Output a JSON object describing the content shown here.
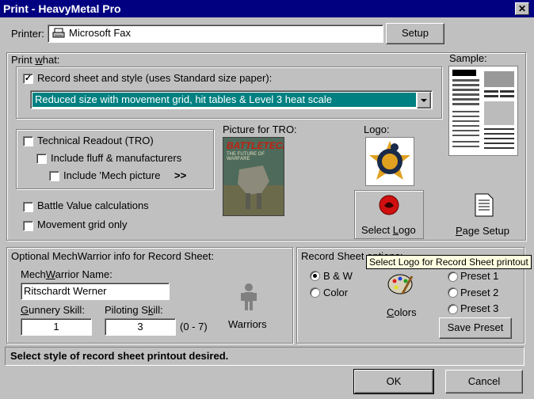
{
  "window": {
    "title": "Print - HeavyMetal Pro",
    "close_glyph": "✕"
  },
  "printer": {
    "label": "Printer:",
    "value": "Microsoft Fax",
    "setup_label": "Setup"
  },
  "print_what": {
    "title": "Print what:",
    "record_sheet": {
      "label": "Record sheet and style (uses Standard size paper):",
      "checked": true
    },
    "style_select": "Reduced size with movement grid, hit tables & Level 3 heat scale",
    "tro": {
      "label": "Technical Readout (TRO)",
      "checked": false
    },
    "fluff": {
      "label": "Include fluff & manufacturers",
      "checked": false
    },
    "mech_picture": {
      "label": "Include 'Mech picture",
      "checked": false
    },
    "more": ">>",
    "picture_for_tro_label": "Picture for TRO:",
    "tro_image_text": "BATTLETECH",
    "tro_image_subtext": "THE FUTURE OF WARFARE",
    "logo_label": "Logo:",
    "battle_value": {
      "label": "Battle Value calculations",
      "checked": false
    },
    "movement_grid": {
      "label": "Movement grid only",
      "checked": false
    },
    "select_logo_label": "Select Logo",
    "page_setup_label": "Page Setup"
  },
  "sample": {
    "label": "Sample:"
  },
  "mechwarrior": {
    "title": "Optional MechWarrior info for Record Sheet:",
    "name_label": "MechWarrior Name:",
    "name_value": "Ritschardt Werner",
    "gunnery_label": "Gunnery Skill:",
    "gunnery_value": "1",
    "piloting_label": "Piloting Skill:",
    "piloting_value": "3",
    "range": "(0 - 7)",
    "warriors_label": "Warriors"
  },
  "record_options": {
    "title": "Record Sheet options:",
    "bw": {
      "label": "B & W",
      "selected": true
    },
    "color": {
      "label": "Color",
      "selected": false
    },
    "colors_label": "Colors",
    "preset1": "Preset 1",
    "preset2": "Preset 2",
    "preset3": "Preset 3",
    "save_preset": "Save Preset"
  },
  "tooltip": "Select Logo for Record Sheet printout",
  "status": "Select style of record sheet printout desired.",
  "buttons": {
    "ok": "OK",
    "cancel": "Cancel"
  },
  "colors": {
    "titlebar": "#000080",
    "selection": "#008080",
    "face": "#c0c0c0"
  },
  "icons": [
    "printer-icon",
    "battletech-image",
    "logo-image",
    "select-logo-icon",
    "page-setup-icon",
    "warrior-icon",
    "palette-icon",
    "sample-thumbnail"
  ]
}
